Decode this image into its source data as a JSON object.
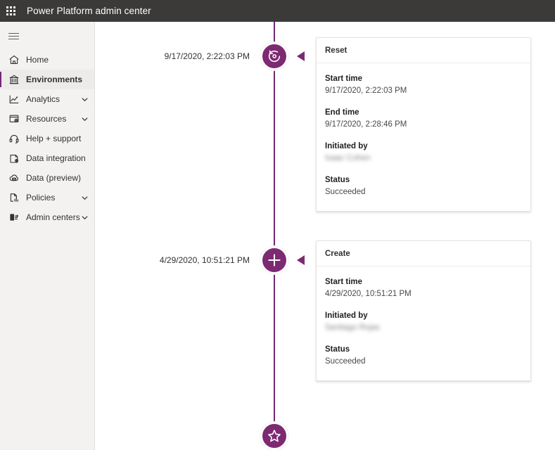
{
  "header": {
    "app_launcher_icon": "waffle-grid-icon",
    "title": "Power Platform admin center"
  },
  "sidebar": {
    "menu_toggle_icon": "hamburger-icon",
    "items": [
      {
        "label": "Home",
        "icon": "home-icon",
        "active": false,
        "chevron": false
      },
      {
        "label": "Environments",
        "icon": "environments-icon",
        "active": true,
        "chevron": false
      },
      {
        "label": "Analytics",
        "icon": "analytics-icon",
        "active": false,
        "chevron": true
      },
      {
        "label": "Resources",
        "icon": "resources-icon",
        "active": false,
        "chevron": true
      },
      {
        "label": "Help + support",
        "icon": "headset-icon",
        "active": false,
        "chevron": false
      },
      {
        "label": "Data integration",
        "icon": "data-integration-icon",
        "active": false,
        "chevron": false
      },
      {
        "label": "Data (preview)",
        "icon": "data-cloud-icon",
        "active": false,
        "chevron": false
      },
      {
        "label": "Policies",
        "icon": "policies-icon",
        "active": false,
        "chevron": true
      },
      {
        "label": "Admin centers",
        "icon": "admin-centers-icon",
        "active": false,
        "chevron": true
      }
    ]
  },
  "timeline": {
    "line_color": "#742774",
    "node_color": "#7d2a72",
    "events": [
      {
        "node_icon": "reset-circular-arrow-icon",
        "date_label": "9/17/2020, 2:22:03 PM",
        "card": {
          "title": "Reset",
          "fields": [
            {
              "label": "Start time",
              "value": "9/17/2020, 2:22:03 PM",
              "redacted": false
            },
            {
              "label": "End time",
              "value": "9/17/2020, 2:28:46 PM",
              "redacted": false
            },
            {
              "label": "Initiated by",
              "value": "Isaac Cohen",
              "redacted": true
            },
            {
              "label": "Status",
              "value": "Succeeded",
              "redacted": false
            }
          ]
        }
      },
      {
        "node_icon": "create-plus-icon",
        "date_label": "4/29/2020, 10:51:21 PM",
        "card": {
          "title": "Create",
          "fields": [
            {
              "label": "Start time",
              "value": "4/29/2020, 10:51:21 PM",
              "redacted": false
            },
            {
              "label": "Initiated by",
              "value": "Santiago Rojas",
              "redacted": true
            },
            {
              "label": "Status",
              "value": "Succeeded",
              "redacted": false
            }
          ]
        }
      }
    ],
    "end_node": {
      "node_icon": "star-icon"
    }
  }
}
